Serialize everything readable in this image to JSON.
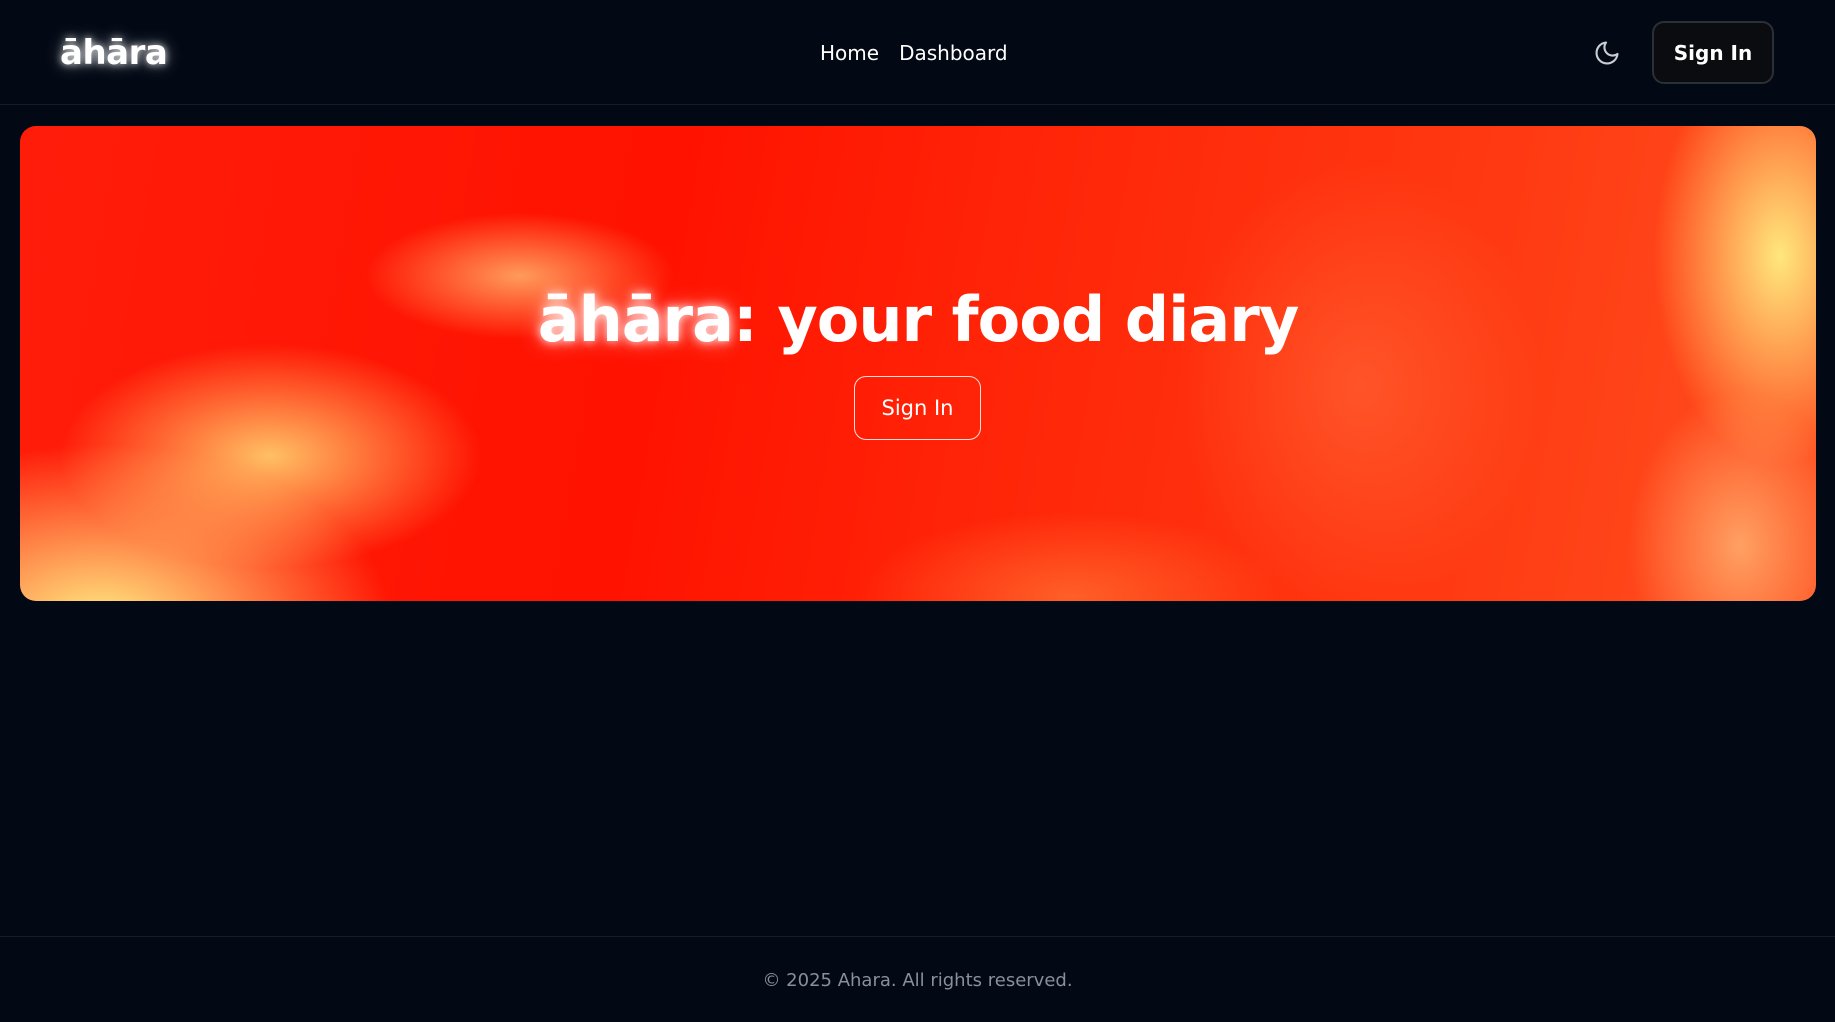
{
  "header": {
    "logo": "āhāra",
    "nav": [
      {
        "label": "Home"
      },
      {
        "label": "Dashboard"
      }
    ],
    "theme_toggle_icon": "moon-icon",
    "signin_label": "Sign In"
  },
  "hero": {
    "brand": "āhāra",
    "tagline": ": your food diary",
    "signin_label": "Sign In"
  },
  "footer": {
    "copyright": "© 2025 Ahara. All rights reserved."
  },
  "colors": {
    "background": "#020814",
    "hero_red": "#ff1200",
    "hero_yellow": "#fff08c",
    "footer_text": "#8a8f99"
  }
}
